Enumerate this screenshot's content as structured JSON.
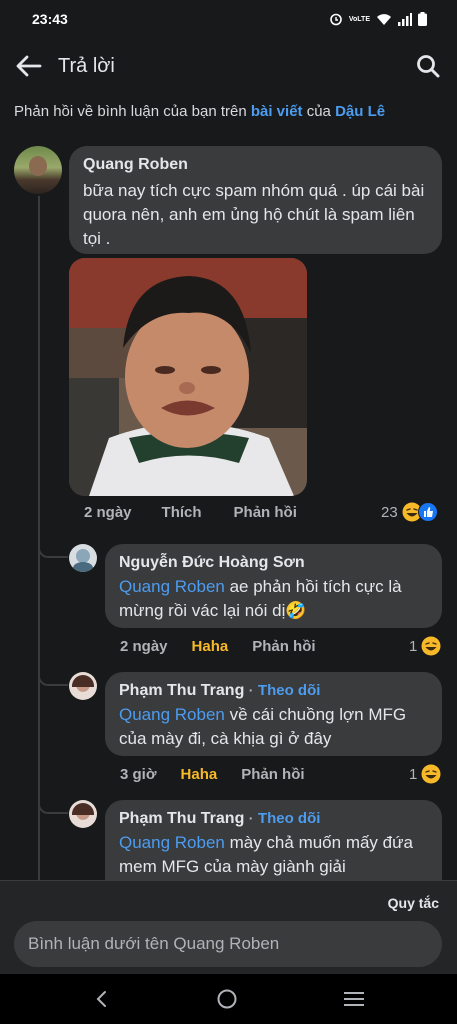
{
  "status_bar": {
    "time": "23:43",
    "network_label": "VoLTE"
  },
  "header": {
    "title": "Trả lời"
  },
  "context": {
    "prefix": "Phản hồi về bình luận của bạn trên ",
    "post_link": "bài viết",
    "middle": " của ",
    "author_link": "Dậu Lê"
  },
  "comments": [
    {
      "author": "Quang Roben",
      "text": "bữa nay tích cực spam nhóm quá . úp cái bài quora nên, anh em ủng hộ chút là spam liên tọi .",
      "time": "2 ngày",
      "action": "Thích",
      "reply": "Phản hồi",
      "reaction_count": "23"
    },
    {
      "author": "Nguyễn Đức Hoàng Sơn",
      "mention": "Quang Roben",
      "text": " ae phản hồi tích cực là mừng rồi vác lại nói dị🤣",
      "time": "2 ngày",
      "action": "Haha",
      "reply": "Phản hồi",
      "reaction_count": "1"
    },
    {
      "author": "Phạm Thu Trang",
      "follow": "Theo dõi",
      "mention": "Quang Roben",
      "text": " về cái chuồng lợn MFG của mày đi, cà khịa gì ở đây",
      "time": "3 giờ",
      "action": "Haha",
      "reply": "Phản hồi",
      "reaction_count": "1"
    },
    {
      "author": "Phạm Thu Trang",
      "follow": "Theo dõi",
      "mention": "Quang Roben",
      "text": " mày chả muốn mấy đứa mem MFG của mày giành giải"
    }
  ],
  "footer": {
    "rules": "Quy tắc",
    "placeholder": "Bình luận dưới tên Quang Roben"
  },
  "colors": {
    "accent": "#4c9cf0",
    "haha": "#f7b928",
    "bubble": "#3a3b3c",
    "background": "#18191a"
  }
}
